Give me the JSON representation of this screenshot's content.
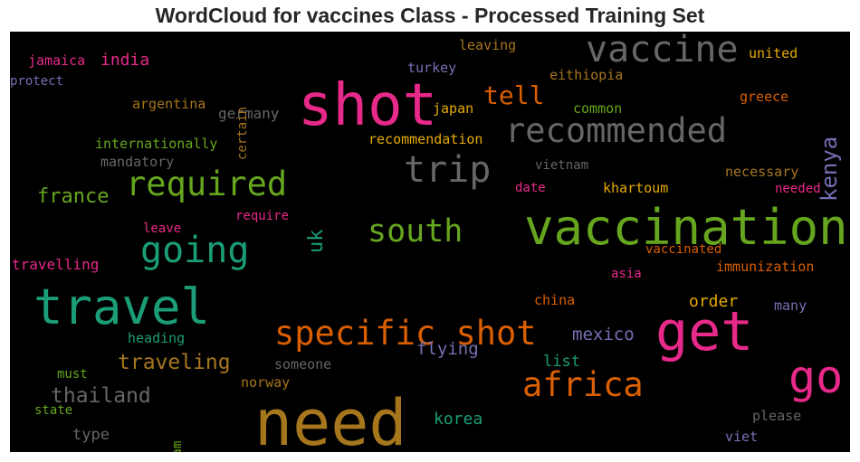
{
  "chart_data": {
    "type": "wordcloud",
    "title": "WordCloud for vaccines Class - Processed Training Set",
    "background": "#000000",
    "words": [
      {
        "text": "need",
        "color": "#a6761d",
        "orientation": "horizontal"
      },
      {
        "text": "shot",
        "color": "#e7298a",
        "orientation": "horizontal"
      },
      {
        "text": "vaccination",
        "color": "#66a61e",
        "orientation": "horizontal"
      },
      {
        "text": "travel",
        "color": "#1b9e77",
        "orientation": "horizontal"
      },
      {
        "text": "get",
        "color": "#e7298a",
        "orientation": "horizontal"
      },
      {
        "text": "specific shot",
        "color": "#d95f02",
        "orientation": "horizontal"
      },
      {
        "text": "vaccine",
        "color": "#666666",
        "orientation": "horizontal"
      },
      {
        "text": "go",
        "color": "#e7298a",
        "orientation": "horizontal"
      },
      {
        "text": "recommended",
        "color": "#666666",
        "orientation": "horizontal"
      },
      {
        "text": "trip",
        "color": "#666666",
        "orientation": "horizontal"
      },
      {
        "text": "required",
        "color": "#66a61e",
        "orientation": "horizontal"
      },
      {
        "text": "going",
        "color": "#1b9e77",
        "orientation": "horizontal"
      },
      {
        "text": "africa",
        "color": "#d95f02",
        "orientation": "horizontal"
      },
      {
        "text": "south",
        "color": "#66a61e",
        "orientation": "horizontal"
      },
      {
        "text": "tell",
        "color": "#d95f02",
        "orientation": "horizontal"
      },
      {
        "text": "traveling",
        "color": "#a6761d",
        "orientation": "horizontal"
      },
      {
        "text": "thailand",
        "color": "#666666",
        "orientation": "horizontal"
      },
      {
        "text": "france",
        "color": "#66a61e",
        "orientation": "horizontal"
      },
      {
        "text": "kenya",
        "color": "#7570b3",
        "orientation": "vertical"
      },
      {
        "text": "mexico",
        "color": "#7570b3",
        "orientation": "horizontal"
      },
      {
        "text": "flying",
        "color": "#7570b3",
        "orientation": "horizontal"
      },
      {
        "text": "korea",
        "color": "#1b9e77",
        "orientation": "horizontal"
      },
      {
        "text": "order",
        "color": "#e6ab02",
        "orientation": "horizontal"
      },
      {
        "text": "india",
        "color": "#e7298a",
        "orientation": "horizontal"
      },
      {
        "text": "germany",
        "color": "#666666",
        "orientation": "horizontal"
      },
      {
        "text": "uk",
        "color": "#1b9e77",
        "orientation": "vertical"
      },
      {
        "text": "travelling",
        "color": "#e7298a",
        "orientation": "horizontal"
      },
      {
        "text": "list",
        "color": "#1b9e77",
        "orientation": "horizontal"
      },
      {
        "text": "type",
        "color": "#666666",
        "orientation": "horizontal"
      },
      {
        "text": "united",
        "color": "#e6ab02",
        "orientation": "horizontal"
      },
      {
        "text": "leaving",
        "color": "#a6761d",
        "orientation": "horizontal"
      },
      {
        "text": "jamaica",
        "color": "#e7298a",
        "orientation": "horizontal"
      },
      {
        "text": "protect",
        "color": "#7570b3",
        "orientation": "horizontal"
      },
      {
        "text": "turkey",
        "color": "#7570b3",
        "orientation": "horizontal"
      },
      {
        "text": "eithiopia",
        "color": "#a6761d",
        "orientation": "horizontal"
      },
      {
        "text": "argentina",
        "color": "#a6761d",
        "orientation": "horizontal"
      },
      {
        "text": "certain",
        "color": "#a6761d",
        "orientation": "vertical"
      },
      {
        "text": "japan",
        "color": "#e6ab02",
        "orientation": "horizontal"
      },
      {
        "text": "common",
        "color": "#66a61e",
        "orientation": "horizontal"
      },
      {
        "text": "greece",
        "color": "#d95f02",
        "orientation": "horizontal"
      },
      {
        "text": "internationally",
        "color": "#66a61e",
        "orientation": "horizontal"
      },
      {
        "text": "recommendation",
        "color": "#e6ab02",
        "orientation": "horizontal"
      },
      {
        "text": "mandatory",
        "color": "#666666",
        "orientation": "horizontal"
      },
      {
        "text": "vietnam",
        "color": "#666666",
        "orientation": "horizontal"
      },
      {
        "text": "necessary",
        "color": "#a6761d",
        "orientation": "horizontal"
      },
      {
        "text": "date",
        "color": "#e7298a",
        "orientation": "horizontal"
      },
      {
        "text": "khartoum",
        "color": "#e6ab02",
        "orientation": "horizontal"
      },
      {
        "text": "needed",
        "color": "#e7298a",
        "orientation": "horizontal"
      },
      {
        "text": "require",
        "color": "#e7298a",
        "orientation": "horizontal"
      },
      {
        "text": "leave",
        "color": "#e7298a",
        "orientation": "horizontal"
      },
      {
        "text": "vaccinated",
        "color": "#d95f02",
        "orientation": "horizontal"
      },
      {
        "text": "asia",
        "color": "#e7298a",
        "orientation": "horizontal"
      },
      {
        "text": "immunization",
        "color": "#d95f02",
        "orientation": "horizontal"
      },
      {
        "text": "china",
        "color": "#d95f02",
        "orientation": "horizontal"
      },
      {
        "text": "many",
        "color": "#7570b3",
        "orientation": "horizontal"
      },
      {
        "text": "heading",
        "color": "#1b9e77",
        "orientation": "horizontal"
      },
      {
        "text": "someone",
        "color": "#666666",
        "orientation": "horizontal"
      },
      {
        "text": "must",
        "color": "#66a61e",
        "orientation": "horizontal"
      },
      {
        "text": "norway",
        "color": "#a6761d",
        "orientation": "horizontal"
      },
      {
        "text": "state",
        "color": "#66a61e",
        "orientation": "horizontal"
      },
      {
        "text": "nam",
        "color": "#66a61e",
        "orientation": "vertical"
      },
      {
        "text": "please",
        "color": "#666666",
        "orientation": "horizontal"
      },
      {
        "text": "viet",
        "color": "#7570b3",
        "orientation": "horizontal"
      }
    ]
  }
}
